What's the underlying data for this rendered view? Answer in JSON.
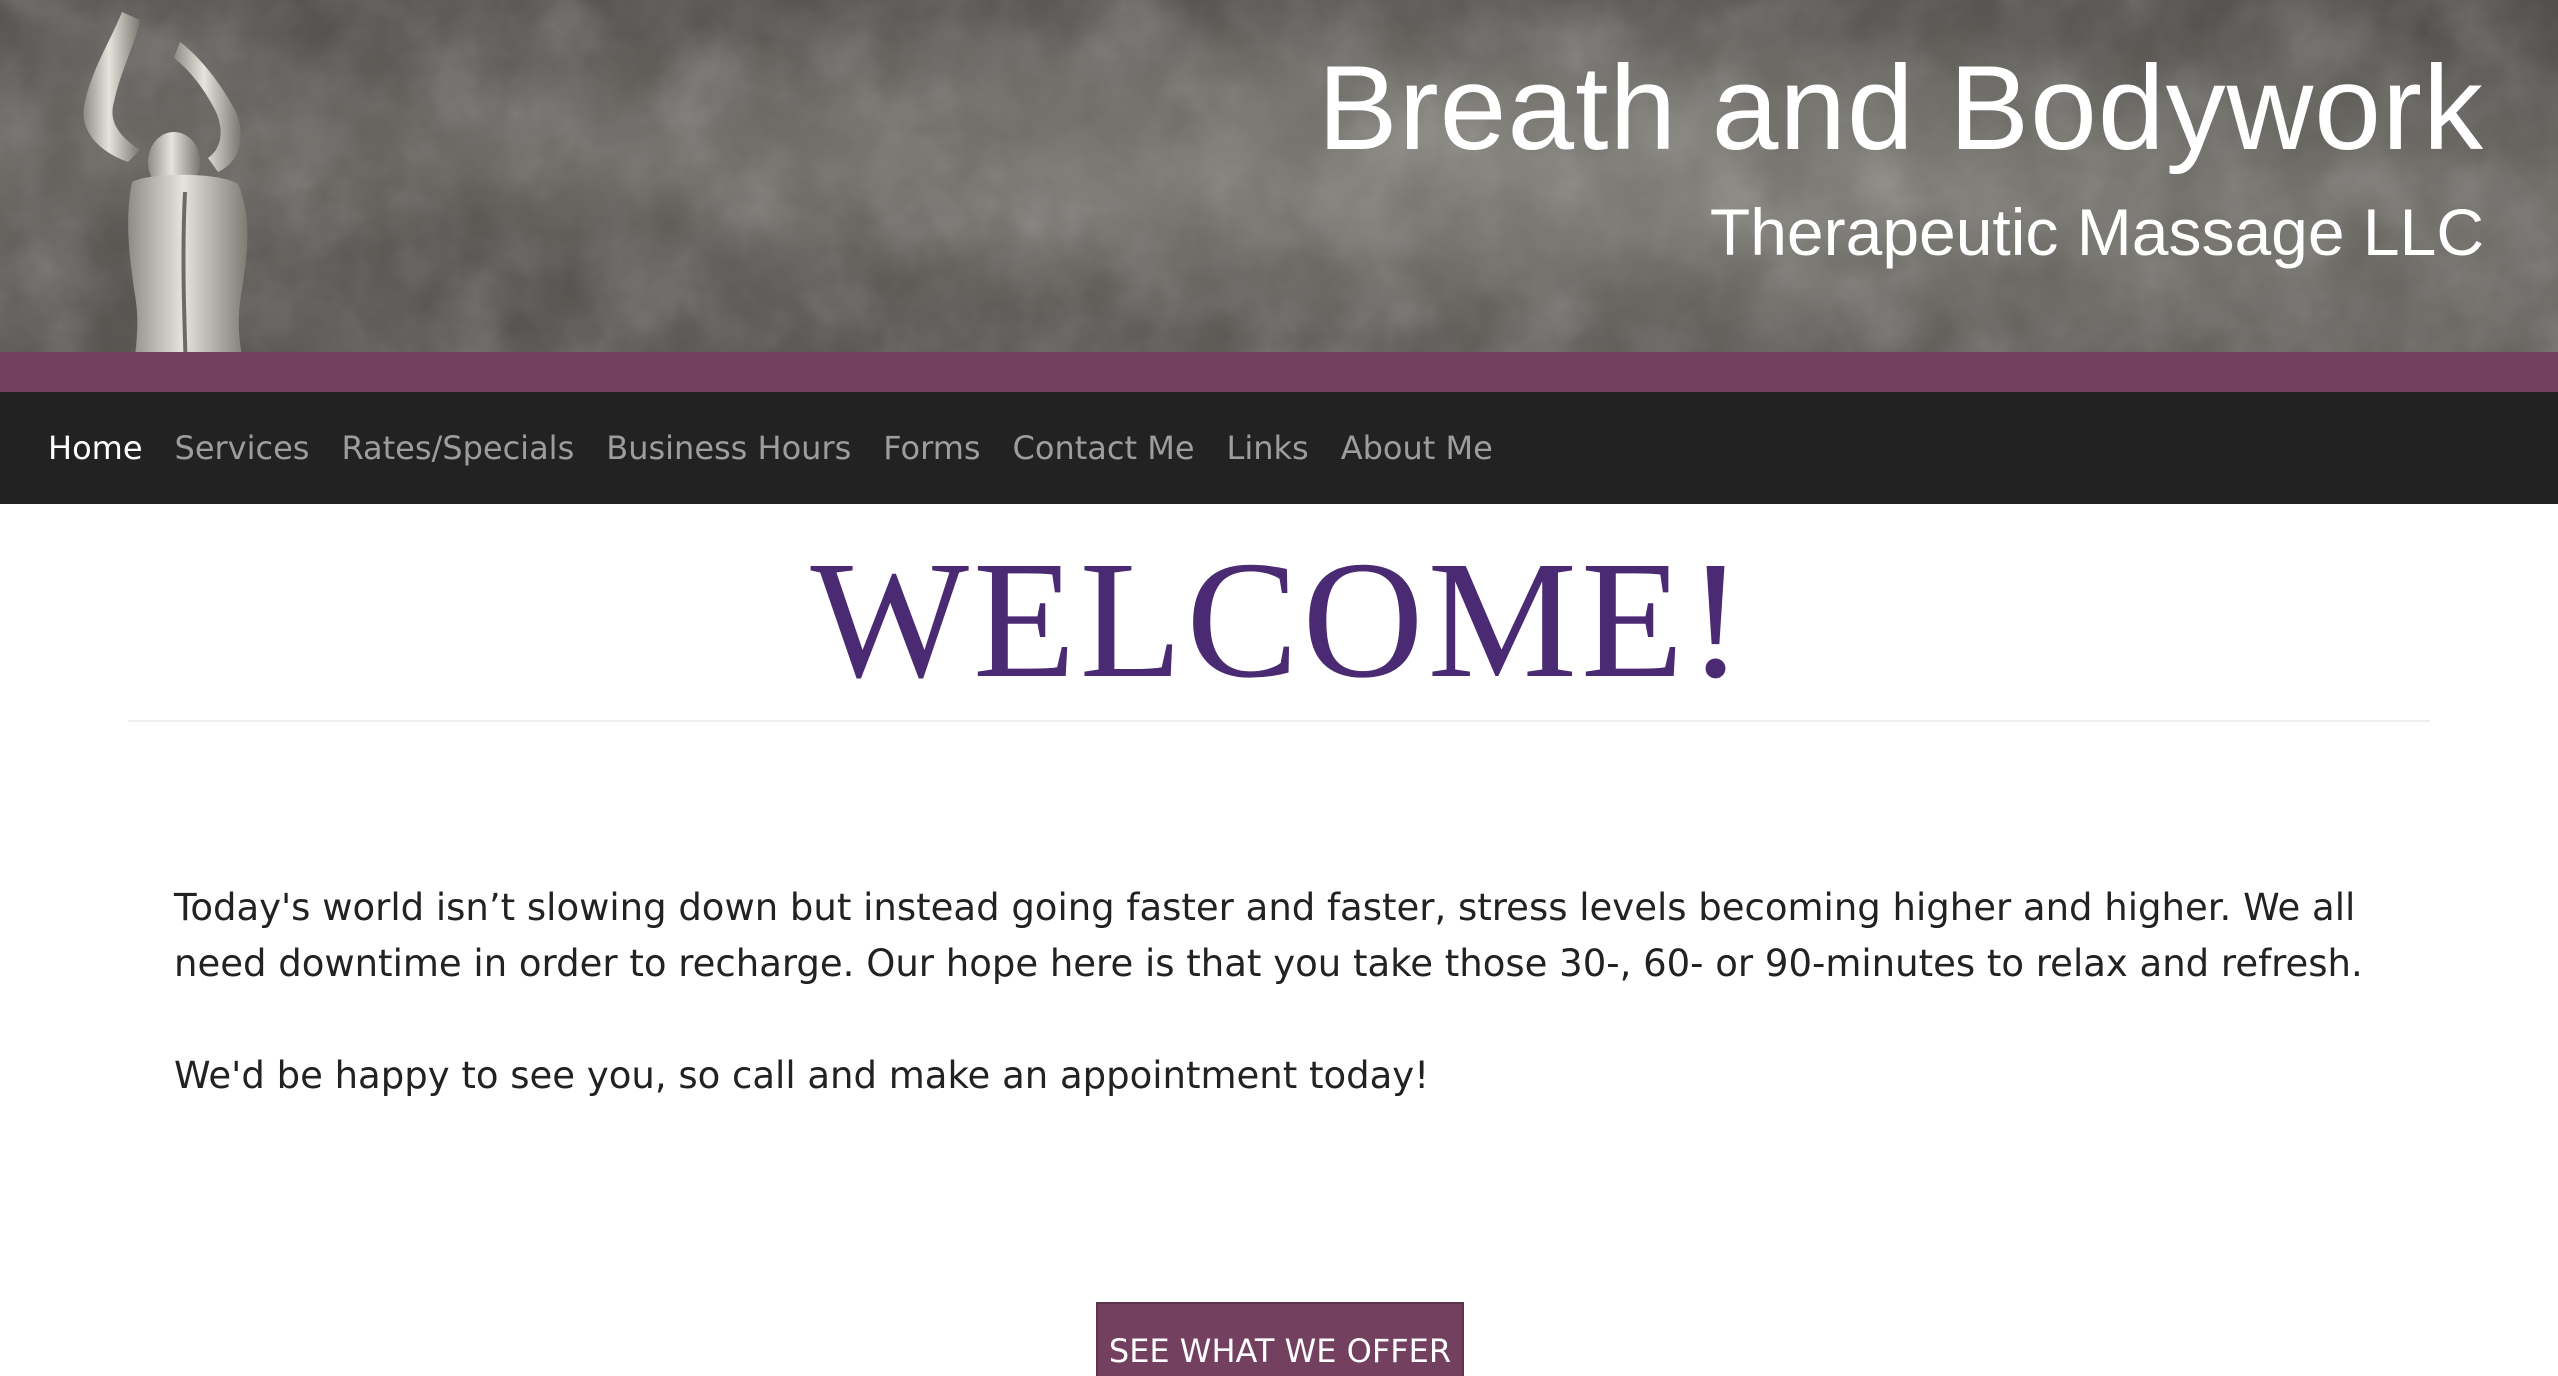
{
  "header": {
    "title": "Breath and Bodywork",
    "subtitle": "Therapeutic Massage LLC",
    "band_color": "#73405f",
    "logo_icon": "stretching-figure-icon"
  },
  "nav": {
    "items": [
      {
        "label": "Home",
        "active": true
      },
      {
        "label": "Services",
        "active": false
      },
      {
        "label": "Rates/Specials",
        "active": false
      },
      {
        "label": "Business Hours",
        "active": false
      },
      {
        "label": "Forms",
        "active": false
      },
      {
        "label": "Contact Me",
        "active": false
      },
      {
        "label": "Links",
        "active": false
      },
      {
        "label": "About Me",
        "active": false
      }
    ]
  },
  "main": {
    "heading": "WELCOME!",
    "heading_color": "#4a2a72",
    "paragraphs": [
      "Today's world isn’t slowing down but instead going faster and faster, stress levels becoming higher and higher. We all need downtime in order to recharge. Our hope here is that you take those 30-, 60- or 90-minutes to relax and refresh.",
      "We'd be happy to see you, so call and make an appointment today!"
    ],
    "cta_label": "SEE WHAT WE OFFER"
  }
}
